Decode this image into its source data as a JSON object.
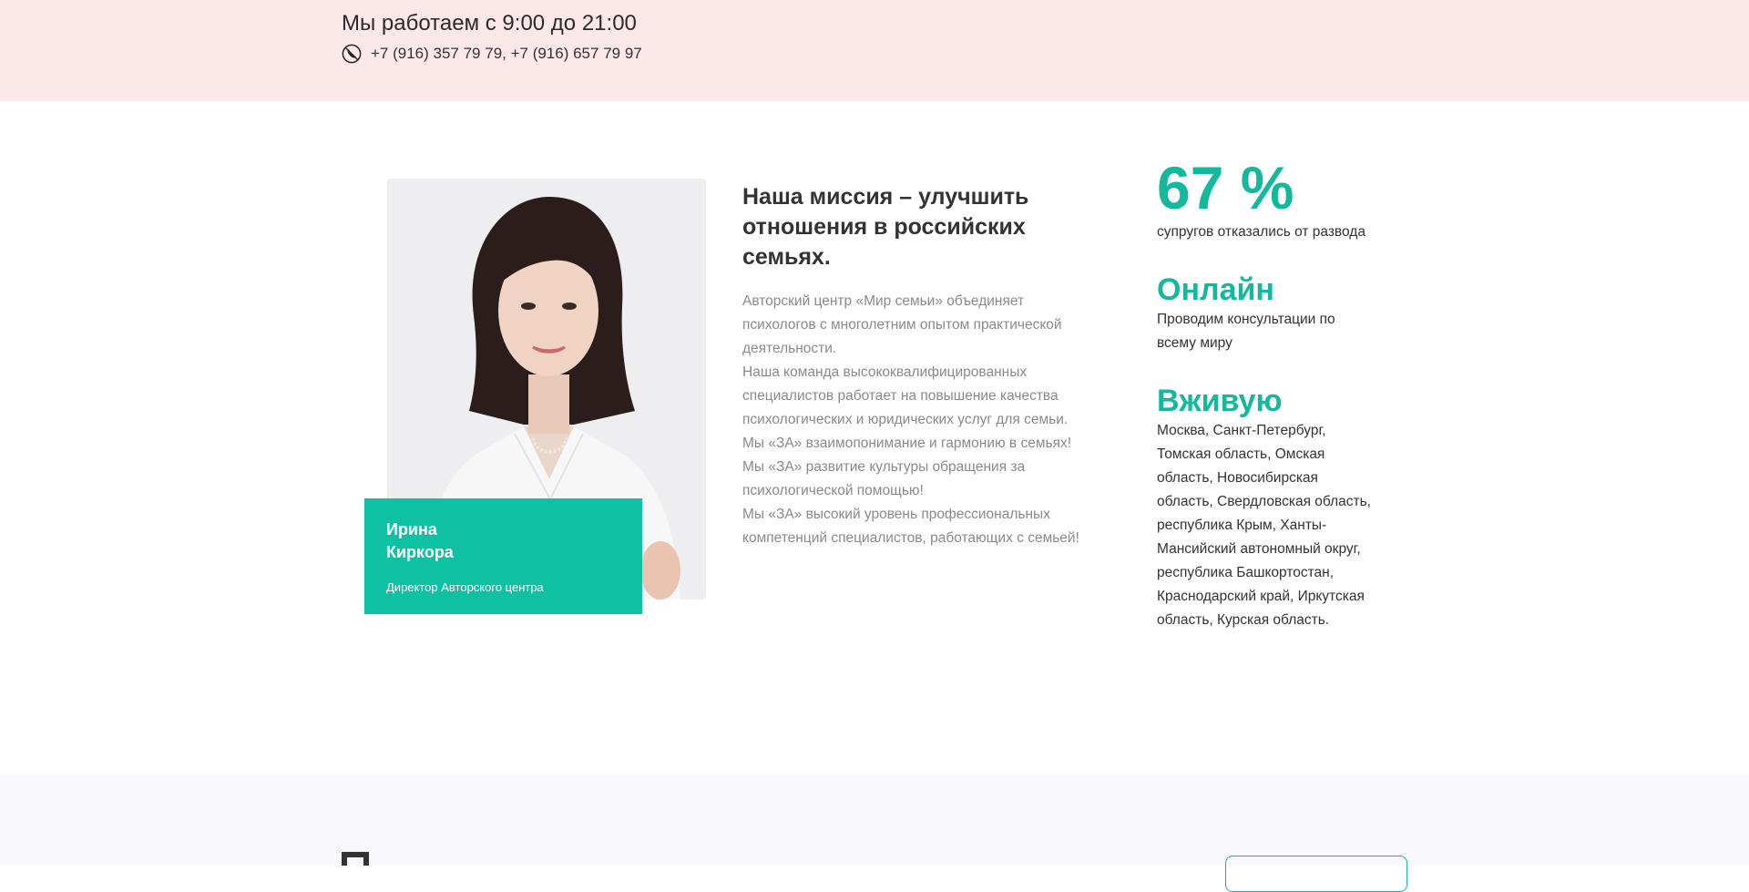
{
  "topbar": {
    "hours": "Мы работаем с 9:00 до 21:00",
    "phones": "+7 (916) 357 79 79, +7 (916) 657 79 97",
    "phone_icon": "phone-icon"
  },
  "director": {
    "name_first": "Ирина",
    "name_last": "Киркора",
    "role": "Директор Авторского центра"
  },
  "mission": {
    "title": "Наша миссия – улучшить отношения в российских семьях.",
    "paragraphs": [
      "Авторский центр «Мир семьи» объединяет психологов с многолетним опытом практической деятельности.",
      "Наша команда высококвалифицированных специалистов работает на повышение качества психологических и юридических услуг для семьи.",
      "Мы «ЗА» взаимопонимание и гармонию в семьях!",
      "Мы «ЗА» развитие культуры обращения за психологической помощью!",
      "Мы «ЗА» высокий уровень профессиональных компетенций специалистов, работающих с семьей!"
    ]
  },
  "stats": [
    {
      "value": "67 %",
      "text": "супругов отказались от развода"
    },
    {
      "value": "Онлайн",
      "text": "Проводим консультации по всему миру"
    },
    {
      "value": "Вживую",
      "text": "Москва, Санкт-Петербург, Томская область, Омская область, Новосибирская область, Свердловская область, республика Крым, Ханты-Мансийский автономный округ, республика Башкортостан, Краснодарский край, Иркутская область, Курская область."
    }
  ],
  "colors": {
    "accent": "#0fc1a3",
    "topbar_bg": "#fde8e9"
  }
}
